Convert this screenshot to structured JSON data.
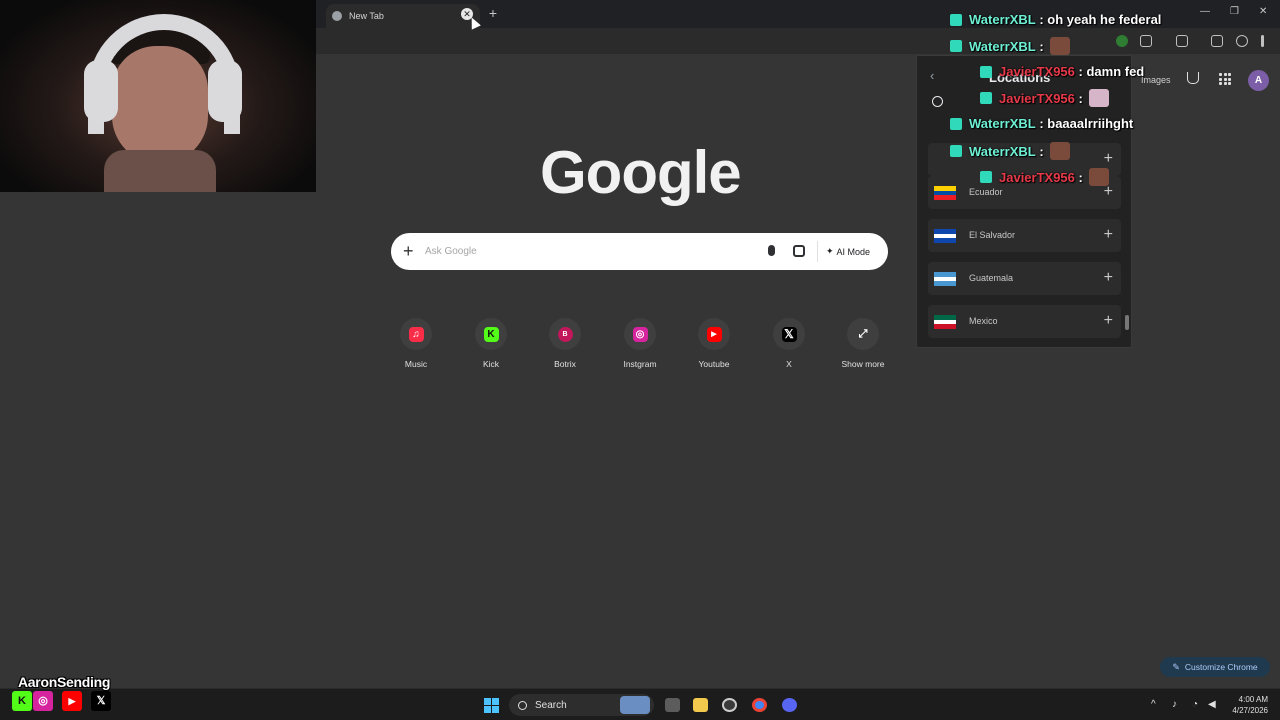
{
  "browser": {
    "tab_title": "New Tab",
    "new_tab_label": "+"
  },
  "google": {
    "logo_text": "Google",
    "search_placeholder": "Ask Google",
    "ai_mode_label": "AI Mode",
    "images_link": "Images",
    "avatar_letter": "A",
    "customize_label": "Customize Chrome"
  },
  "shortcuts": [
    {
      "label": "Music",
      "icon": "music-icon",
      "color": "#fa2d48"
    },
    {
      "label": "Kick",
      "icon": "kick-icon",
      "color": "#53fc18"
    },
    {
      "label": "Botrix",
      "icon": "botrix-icon",
      "color": "#c2185b"
    },
    {
      "label": "Instgram",
      "icon": "instagram-icon",
      "color": "#d6249f"
    },
    {
      "label": "Youtube",
      "icon": "youtube-icon",
      "color": "#ff0000"
    },
    {
      "label": "X",
      "icon": "x-icon",
      "color": "#000000"
    },
    {
      "label": "Show more",
      "icon": "expand-icon",
      "color": "#3f3f3f"
    }
  ],
  "locations_panel": {
    "title": "Locations",
    "items": [
      {
        "name": "Ecuador",
        "flag": [
          "#ffd100",
          "#034ea2",
          "#ed1c24"
        ]
      },
      {
        "name": "El Salvador",
        "flag": [
          "#0f47af",
          "#ffffff",
          "#0f47af"
        ]
      },
      {
        "name": "Guatemala",
        "flag": [
          "#4997d0",
          "#ffffff",
          "#4997d0"
        ]
      },
      {
        "name": "Mexico",
        "flag": [
          "#006847",
          "#ffffff",
          "#ce1126"
        ]
      }
    ]
  },
  "chat": [
    {
      "user": "WaterrXBL",
      "message": "oh yeah he federal",
      "user_color": "green"
    },
    {
      "user": "WaterrXBL",
      "message": "",
      "emote": true,
      "user_color": "green"
    },
    {
      "user": "JavierTX956",
      "message": "damn fed",
      "user_color": "red"
    },
    {
      "user": "JavierTX956",
      "message": "",
      "emote": true,
      "user_color": "red"
    },
    {
      "user": "WaterrXBL",
      "message": "baaaalrriihght",
      "user_color": "green"
    },
    {
      "user": "WaterrXBL",
      "message": "",
      "emote": true,
      "user_color": "green"
    },
    {
      "user": "JavierTX956",
      "message": "",
      "emote": true,
      "user_color": "red"
    }
  ],
  "stream_overlay": {
    "handle": "AaronSending"
  },
  "taskbar": {
    "search_label": "Search",
    "time": "4:00 AM",
    "date": "4/27/2026"
  }
}
